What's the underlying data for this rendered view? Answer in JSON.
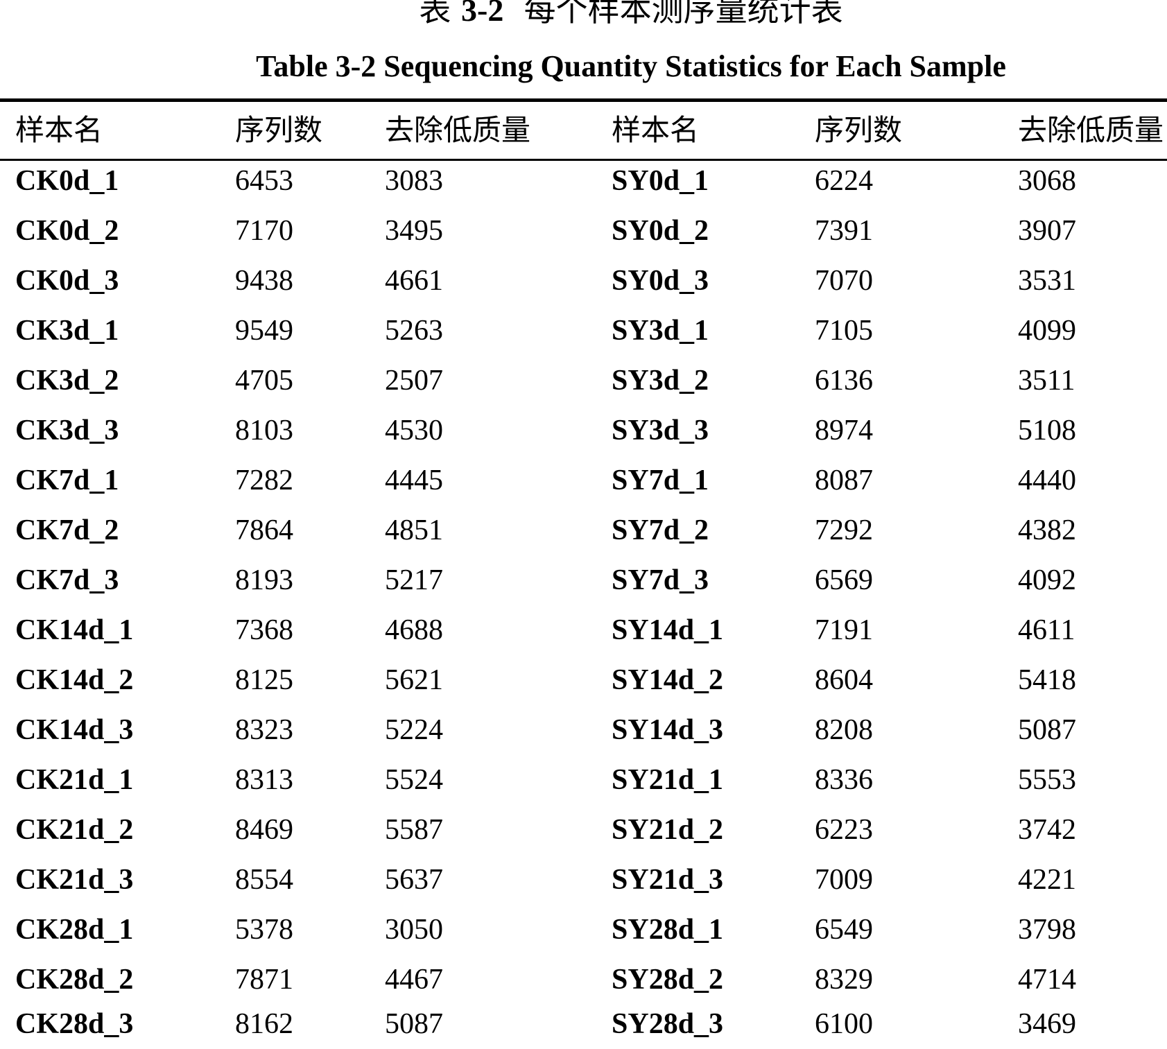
{
  "caption": {
    "cn_label": "表",
    "number": "3-2",
    "cn_title": "每个样本测序量统计表",
    "en_title": "Table 3-2 Sequencing Quantity Statistics for Each Sample"
  },
  "headers": [
    "样本名",
    "序列数",
    "去除低质量",
    "样本名",
    "序列数",
    "去除低质量"
  ],
  "rows": [
    [
      "CK0d_1",
      "6453",
      "3083",
      "SY0d_1",
      "6224",
      "3068"
    ],
    [
      "CK0d_2",
      "7170",
      "3495",
      "SY0d_2",
      "7391",
      "3907"
    ],
    [
      "CK0d_3",
      "9438",
      "4661",
      "SY0d_3",
      "7070",
      "3531"
    ],
    [
      "CK3d_1",
      "9549",
      "5263",
      "SY3d_1",
      "7105",
      "4099"
    ],
    [
      "CK3d_2",
      "4705",
      "2507",
      "SY3d_2",
      "6136",
      "3511"
    ],
    [
      "CK3d_3",
      "8103",
      "4530",
      "SY3d_3",
      "8974",
      "5108"
    ],
    [
      "CK7d_1",
      "7282",
      "4445",
      "SY7d_1",
      "8087",
      "4440"
    ],
    [
      "CK7d_2",
      "7864",
      "4851",
      "SY7d_2",
      "7292",
      "4382"
    ],
    [
      "CK7d_3",
      "8193",
      "5217",
      "SY7d_3",
      "6569",
      "4092"
    ],
    [
      "CK14d_1",
      "7368",
      "4688",
      "SY14d_1",
      "7191",
      "4611"
    ],
    [
      "CK14d_2",
      "8125",
      "5621",
      "SY14d_2",
      "8604",
      "5418"
    ],
    [
      "CK14d_3",
      "8323",
      "5224",
      "SY14d_3",
      "8208",
      "5087"
    ],
    [
      "CK21d_1",
      "8313",
      "5524",
      "SY21d_1",
      "8336",
      "5553"
    ],
    [
      "CK21d_2",
      "8469",
      "5587",
      "SY21d_2",
      "6223",
      "3742"
    ],
    [
      "CK21d_3",
      "8554",
      "5637",
      "SY21d_3",
      "7009",
      "4221"
    ],
    [
      "CK28d_1",
      "5378",
      "3050",
      "SY28d_1",
      "6549",
      "3798"
    ],
    [
      "CK28d_2",
      "7871",
      "4467",
      "SY28d_2",
      "8329",
      "4714"
    ],
    [
      "CK28d_3",
      "8162",
      "5087",
      "SY28d_3",
      "6100",
      "3469"
    ]
  ]
}
